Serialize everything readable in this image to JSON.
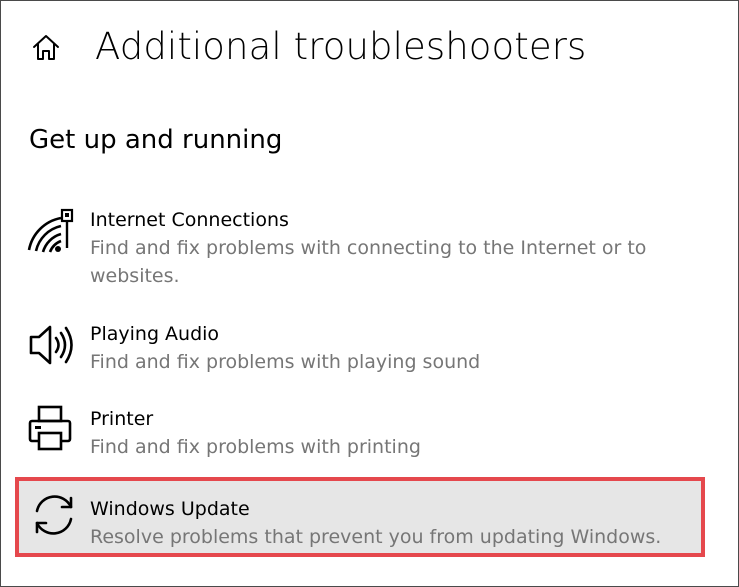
{
  "header": {
    "home_icon": "home-icon",
    "title": "Additional troubleshooters"
  },
  "section": {
    "title": "Get up and running"
  },
  "items": [
    {
      "icon": "network-signal-icon",
      "title": "Internet Connections",
      "description": "Find and fix problems with connecting to the Internet or to websites."
    },
    {
      "icon": "speaker-icon",
      "title": "Playing Audio",
      "description": "Find and fix problems with playing sound"
    },
    {
      "icon": "printer-icon",
      "title": "Printer",
      "description": "Find and fix problems with printing"
    },
    {
      "icon": "refresh-icon",
      "title": "Windows Update",
      "description": "Resolve problems that prevent you from updating Windows.",
      "selected": true
    }
  ],
  "colors": {
    "highlight_border": "#e5484d",
    "selected_background": "#e6e6e6",
    "description_text": "#767676"
  }
}
